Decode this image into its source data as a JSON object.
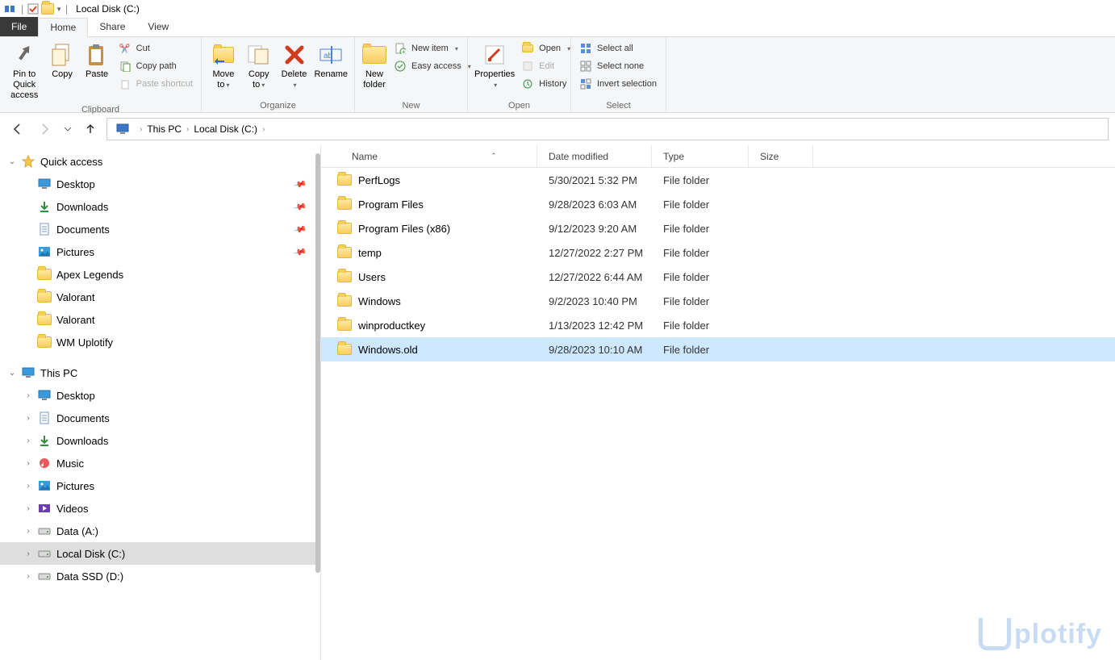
{
  "title_bar": {
    "window_title": "Local Disk (C:)"
  },
  "tabs": {
    "file": "File",
    "home": "Home",
    "share": "Share",
    "view": "View"
  },
  "ribbon": {
    "clipboard": {
      "label": "Clipboard",
      "pin": "Pin to Quick access",
      "copy": "Copy",
      "paste": "Paste",
      "cut": "Cut",
      "copy_path": "Copy path",
      "paste_shortcut": "Paste shortcut"
    },
    "organize": {
      "label": "Organize",
      "move_to": "Move to",
      "copy_to": "Copy to",
      "delete": "Delete",
      "rename": "Rename"
    },
    "new": {
      "label": "New",
      "new_folder": "New folder",
      "new_item": "New item",
      "easy_access": "Easy access"
    },
    "open": {
      "label": "Open",
      "properties": "Properties",
      "open": "Open",
      "edit": "Edit",
      "history": "History"
    },
    "select": {
      "label": "Select",
      "select_all": "Select all",
      "select_none": "Select none",
      "invert": "Invert selection"
    }
  },
  "breadcrumb": {
    "seg1": "This PC",
    "seg2": "Local Disk (C:)"
  },
  "columns": {
    "name": "Name",
    "date": "Date modified",
    "type": "Type",
    "size": "Size"
  },
  "sidebar": {
    "quick_access": "Quick access",
    "this_pc": "This PC",
    "qa_items": [
      {
        "label": "Desktop",
        "pinned": true
      },
      {
        "label": "Downloads",
        "pinned": true
      },
      {
        "label": "Documents",
        "pinned": true
      },
      {
        "label": "Pictures",
        "pinned": true
      },
      {
        "label": "Apex Legends",
        "pinned": false
      },
      {
        "label": "Valorant",
        "pinned": false
      },
      {
        "label": "Valorant",
        "pinned": false
      },
      {
        "label": "WM Uplotify",
        "pinned": false
      }
    ],
    "pc_items": [
      {
        "label": "Desktop"
      },
      {
        "label": "Documents"
      },
      {
        "label": "Downloads"
      },
      {
        "label": "Music"
      },
      {
        "label": "Pictures"
      },
      {
        "label": "Videos"
      },
      {
        "label": "Data (A:)"
      },
      {
        "label": "Local Disk (C:)",
        "selected": true
      },
      {
        "label": "Data SSD (D:)"
      }
    ]
  },
  "files": [
    {
      "name": "PerfLogs",
      "date": "5/30/2021 5:32 PM",
      "type": "File folder",
      "size": ""
    },
    {
      "name": "Program Files",
      "date": "9/28/2023 6:03 AM",
      "type": "File folder",
      "size": ""
    },
    {
      "name": "Program Files (x86)",
      "date": "9/12/2023 9:20 AM",
      "type": "File folder",
      "size": ""
    },
    {
      "name": "temp",
      "date": "12/27/2022 2:27 PM",
      "type": "File folder",
      "size": ""
    },
    {
      "name": "Users",
      "date": "12/27/2022 6:44 AM",
      "type": "File folder",
      "size": ""
    },
    {
      "name": "Windows",
      "date": "9/2/2023 10:40 PM",
      "type": "File folder",
      "size": ""
    },
    {
      "name": "winproductkey",
      "date": "1/13/2023 12:42 PM",
      "type": "File folder",
      "size": ""
    },
    {
      "name": "Windows.old",
      "date": "9/28/2023 10:10 AM",
      "type": "File folder",
      "size": "",
      "selected": true
    }
  ],
  "watermark": "plotify"
}
